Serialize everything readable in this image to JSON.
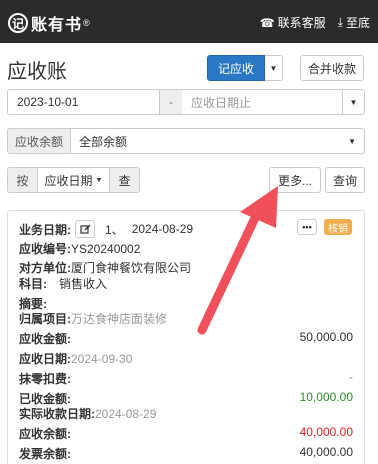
{
  "app": {
    "logo_mark": "记",
    "brand": "账有书",
    "reg_mark": "®"
  },
  "topbar": {
    "service_label": "联系客服",
    "bottom_label": "至底"
  },
  "page": {
    "title": "应收账"
  },
  "toolbar": {
    "add_label": "记应收",
    "merge_label": "合并收款"
  },
  "filters": {
    "date_start": "2023-10-01",
    "date_sep": "-",
    "date_end_placeholder": "应收日期止",
    "balance_label": "应收余额",
    "balance_value": "全部余额",
    "sort_label": "按",
    "sort_value": "应收日期",
    "check_label": "查",
    "more_label": "更多...",
    "query_label": "查询"
  },
  "record": {
    "biz_date_label": "业务日期:",
    "index": "1、",
    "biz_date": "2024-08-29",
    "badge": "核销",
    "code_label": "应收编号:",
    "code": "YS20240002",
    "party_label": "对方单位:",
    "party": "厦门食神餐饮有限公司",
    "subject_label": "科目:",
    "subject": "销售收入",
    "summary_label": "摘要:",
    "project_label": "归属项目:",
    "project": "万达食神店面装修",
    "amount_label": "应收金额:",
    "amount": "50,000.00",
    "due_label": "应收日期:",
    "due": "2024-09-30",
    "discount_label": "抹零扣费:",
    "discount": "-",
    "received_label": "已收金额:",
    "received": "10,000.00",
    "receipt_date_label": "实际收款日期:",
    "receipt_date": "2024-08-29",
    "balance_label": "应收余额:",
    "balance": "40,000.00",
    "invoice_label": "发票余额:",
    "invoice": "40,000.00"
  },
  "colors": {
    "primary": "#2a78c4",
    "badge": "#f0ad4e",
    "received": "#2e8b2e",
    "balance": "#e02020",
    "arrow": "#f0505a"
  }
}
